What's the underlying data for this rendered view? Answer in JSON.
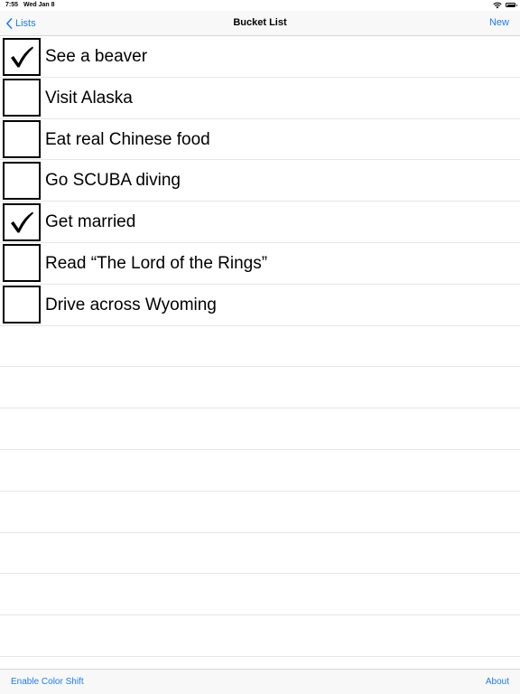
{
  "status_bar": {
    "time": "7:55",
    "date": "Wed Jan 8",
    "icons": [
      "wifi-icon",
      "battery-icon"
    ]
  },
  "nav": {
    "back_label": "Lists",
    "title": "Bucket List",
    "new_label": "New"
  },
  "items": [
    {
      "label": "See a beaver",
      "checked": true
    },
    {
      "label": "Visit Alaska",
      "checked": false
    },
    {
      "label": "Eat real Chinese food",
      "checked": false
    },
    {
      "label": "Go SCUBA diving",
      "checked": false
    },
    {
      "label": "Get married",
      "checked": true
    },
    {
      "label": "Read “The Lord of the Rings”",
      "checked": false
    },
    {
      "label": "Drive across Wyoming",
      "checked": false
    }
  ],
  "toolbar": {
    "left_label": "Enable Color Shift",
    "right_label": "About"
  },
  "colors": {
    "accent": "#1a7cf2",
    "bar_background": "#f8f8f8",
    "separator": "#e6e6e6"
  }
}
